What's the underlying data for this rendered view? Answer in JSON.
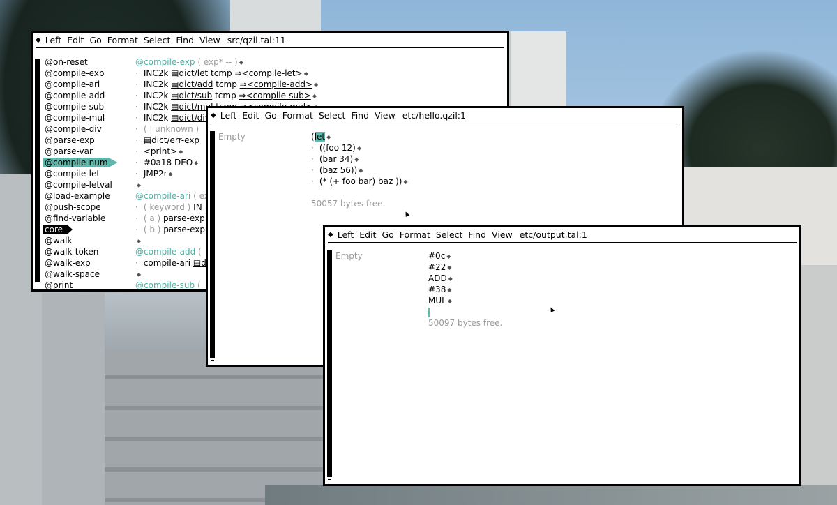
{
  "menu_labels": [
    "Left",
    "Edit",
    "Go",
    "Format",
    "Select",
    "Find",
    "View"
  ],
  "windows": {
    "qzil": {
      "path": "src/qzil.tal:11",
      "symbols": [
        "@on-reset",
        "@compile-exp",
        "@compile-ari",
        "@compile-add",
        "@compile-sub",
        "@compile-mul",
        "@compile-div",
        "@parse-exp",
        "@parse-var",
        "@compile-num",
        "@compile-let",
        "@compile-letval",
        "@load-example",
        "@push-scope",
        "@find-variable",
        "core",
        "@walk",
        "@walk-token",
        "@walk-exp",
        "@walk-space",
        "@print"
      ],
      "code": [
        {
          "parts": [
            "@compile-exp",
            " ( exp* -- )"
          ]
        },
        {
          "parts": [
            "INC2k",
            "dict/let",
            "tcmp",
            "<compile-let>"
          ]
        },
        {
          "parts": [
            "INC2k",
            "dict/add",
            "tcmp",
            "<compile-add>"
          ]
        },
        {
          "parts": [
            "INC2k",
            "dict/sub",
            "tcmp",
            "<compile-sub>"
          ]
        },
        {
          "parts": [
            "INC2k",
            "dict/mul",
            "tcmp",
            "<compile-mul>"
          ]
        },
        {
          "parts": [
            "INC2k",
            "dict/div"
          ]
        },
        {
          "parts": [
            "( | unknown )"
          ]
        },
        {
          "parts": [
            "dict/err-exp"
          ]
        },
        {
          "parts": [
            "<print>"
          ]
        },
        {
          "parts": [
            "#0a18 DEO"
          ]
        },
        {
          "parts": [
            "JMP2r"
          ]
        },
        {
          "parts": [
            ""
          ]
        },
        {
          "parts": [
            "@compile-ari",
            "( ex"
          ]
        },
        {
          "parts": [
            "( keyword )",
            "IN"
          ]
        },
        {
          "parts": [
            "( a )",
            "parse-exp"
          ]
        },
        {
          "parts": [
            "( b )",
            "parse-exp"
          ]
        },
        {
          "parts": [
            ""
          ]
        },
        {
          "parts": [
            "@compile-add",
            "("
          ]
        },
        {
          "parts": [
            "compile-ari",
            "d"
          ]
        },
        {
          "parts": [
            ""
          ]
        },
        {
          "parts": [
            "@compile-sub",
            "("
          ]
        }
      ]
    },
    "hello": {
      "path": "etc/hello.qzil:1",
      "sidebar": "Empty",
      "lines": [
        "(",
        "let",
        "((foo 12)",
        "(bar 34)",
        "(baz 56))",
        "(* (+ foo bar) baz ))"
      ],
      "bytes_free": "50057 bytes free."
    },
    "output": {
      "path": "etc/output.tal:1",
      "sidebar": "Empty",
      "lines": [
        "#0c",
        "#22",
        "ADD",
        "#38",
        "MUL"
      ],
      "bytes_free": "50097 bytes free."
    }
  },
  "colors": {
    "accent": "#5fb8ab",
    "muted": "#9a9a9a",
    "border": "#000000"
  }
}
